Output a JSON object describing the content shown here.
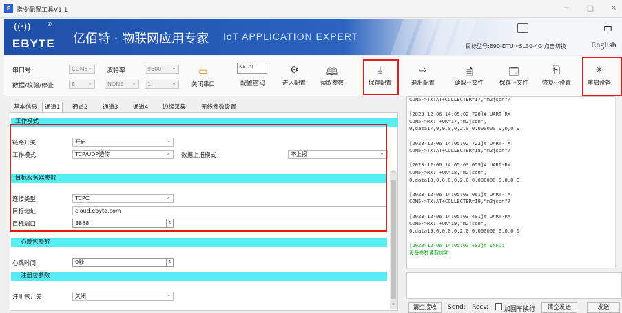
{
  "window": {
    "title": "指令配置工具V1.1",
    "icon_text": "E",
    "minimize": "─",
    "maximize": "□",
    "close": "✕"
  },
  "banner": {
    "logo_symbol": "((·))",
    "logo_reg": "®",
    "logo_text": "EBYTE",
    "title_cn": "亿佰特 · 物联网应用专家",
    "title_en": "IoT APPLICATION EXPERT",
    "model_label": "目标型号:E90-DTU···SL30-4G 点击切换",
    "lang_label": "English"
  },
  "toolbar": {
    "port_label": "串口号",
    "port_value": "COM5",
    "baud_label": "波特率",
    "baud_value": "9600",
    "serial_label": "数据/校验/停止",
    "data_value": "8",
    "parity_value": "NONE",
    "stop_value": "1",
    "close_port": "关闭串口",
    "netat_value": "NETAT",
    "password": "配置密码",
    "enter_config": "进入配置",
    "read_params": "读取参数",
    "save_config": "保存配置",
    "exit_config": "退出配置",
    "read_file": "读取···文件",
    "save_file": "保存···文件",
    "restore": "恢复···设置",
    "restart": "重启设备"
  },
  "tabs": [
    "基本信息",
    "通道1",
    "通道2",
    "通道3",
    "通道4",
    "边缘采集",
    "无线参数设置"
  ],
  "selected_tab": "通道1",
  "form": {
    "section_work": "工作模式",
    "link_switch_label": "链路开关",
    "link_switch_value": "开启",
    "work_mode_label": "工作模式",
    "work_mode_value": "TCP/UDP透传",
    "report_label": "数据上报模式",
    "report_value": "不上报",
    "section_server": "目标服务器参数",
    "conn_type_label": "连接类型",
    "conn_type_value": "TCPC",
    "addr_label": "目标地址",
    "addr_value": "cloud.ebyte.com",
    "port_label": "目标端口",
    "port_value": "8888",
    "section_heartbeat": "心跳包参数",
    "hb_time_label": "心跳时间",
    "hb_time_value": "0秒",
    "section_register": "注册包参数",
    "reg_switch_label": "注册包开关",
    "reg_switch_value": "关闭"
  },
  "log": [
    "COM5->TX:AT+COLLECTER=17,\"m2json\"?",
    "",
    "[2023-12-06 14:05:02.720]# UART-RX:",
    "COM5->RX: +OK=17,\"m2json\",",
    "0,data17,0,0,0,0,2,0,0.000000,0,0,0,0",
    "",
    "[2023-12-06 14:05:02.722]# UART-TX:",
    "COM5->TX:AT+COLLECTER=18,\"m2json\"?",
    "",
    "[2023-12-06 14:05:03.059]# UART-RX:",
    "COM5->RX: +OK=18,\"m2json\",",
    "0,data18,0,0,0,0,2,0,0.000000,0,0,0,0",
    "",
    "[2023-12-06 14:05:03.061]# UART-TX:",
    "COM5->TX:AT+COLLECTER=19,\"m2json\"?",
    "",
    "[2023-12-06 14:05:03.401]# UART-RX:",
    "COM5->RX: +OK=19,\"m2json\",",
    "0,data19,0,0,0,0,2,0,0.000000,0,0,0,0",
    "",
    "[2023-12-06 14:05:03.403]# INFO:",
    "设备参数读取成功"
  ],
  "bottom": {
    "clear_recv": "清空接收",
    "send_label": "Send:",
    "recv_label": "Recv:",
    "crlf": "加回车换行",
    "clear_send": "清空发送",
    "send": "发送"
  },
  "colors": {
    "section_bg": "#55eef5",
    "highlight": "#e21b1b",
    "info_green": "#19a31d",
    "banner": "#2b63bf"
  }
}
